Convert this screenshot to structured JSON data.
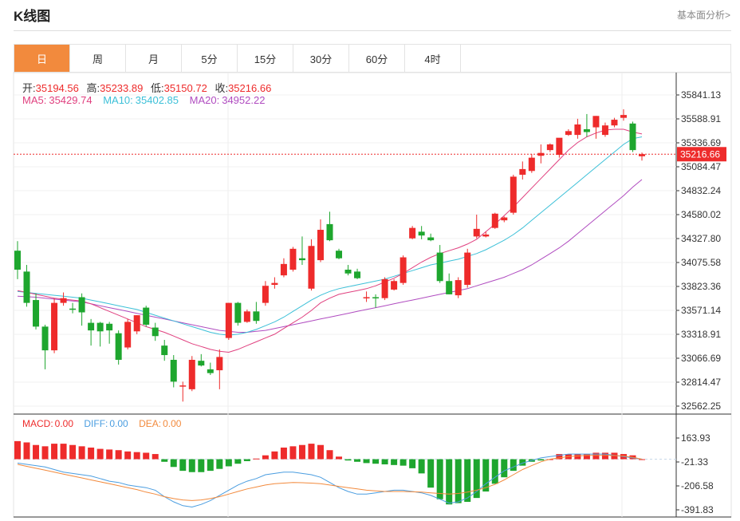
{
  "page": {
    "title": "K线图",
    "sublink": "基本面分析>"
  },
  "tabs": [
    "日",
    "周",
    "月",
    "5分",
    "15分",
    "30分",
    "60分",
    "4时"
  ],
  "active_tab": "日",
  "ohlc_info": {
    "open_label": "开:",
    "open": "35194.56",
    "high_label": "高:",
    "high": "35233.89",
    "low_label": "低:",
    "low": "35150.72",
    "close_label": "收:",
    "close": "35216.66"
  },
  "ma_info": {
    "ma5_label": "MA5:",
    "ma5": "35429.74",
    "ma10_label": "MA10:",
    "ma10": "35402.85",
    "ma20_label": "MA20:",
    "ma20": "34952.22"
  },
  "macd_info": {
    "macd_label": "MACD:",
    "macd": "0.00",
    "diff_label": "DIFF:",
    "diff": "0.00",
    "dea_label": "DEA:",
    "dea": "0.00"
  },
  "colors": {
    "up": "#ee2b2b",
    "down": "#1ea62e",
    "ma5": "#e0407f",
    "ma10": "#3cc0d8",
    "ma20": "#b04cc0",
    "diff": "#4a9de0",
    "dea": "#f28a3d",
    "active_tab": "#f28a3d",
    "price_tag": "#ee2b2b"
  },
  "chart_data": {
    "type": "candlestick",
    "price_axis_ticks": [
      "35841.13",
      "35588.91",
      "35336.69",
      "35084.47",
      "34832.24",
      "34580.02",
      "34327.80",
      "34075.58",
      "33823.36",
      "33571.14",
      "33318.91",
      "33066.69",
      "32814.47",
      "32562.25"
    ],
    "price_range": [
      32562.25,
      35841.13
    ],
    "last_price_tag": "35216.66",
    "macd_axis_ticks": [
      "163.93",
      "-21.33",
      "-206.58",
      "-391.83"
    ],
    "macd_range": [
      -391.83,
      163.93
    ],
    "candles": [
      [
        34200,
        34300,
        33900,
        34000
      ],
      [
        33980,
        34050,
        33610,
        33650
      ],
      [
        33680,
        33750,
        33370,
        33400
      ],
      [
        33400,
        33420,
        32950,
        33150
      ],
      [
        33150,
        33700,
        33120,
        33650
      ],
      [
        33650,
        33760,
        33620,
        33700
      ],
      [
        33590,
        33650,
        33540,
        33580
      ],
      [
        33710,
        33750,
        33410,
        33550
      ],
      [
        33440,
        33480,
        33200,
        33360
      ],
      [
        33440,
        33450,
        33190,
        33350
      ],
      [
        33430,
        33450,
        33220,
        33360
      ],
      [
        33330,
        33360,
        33000,
        33050
      ],
      [
        33180,
        33480,
        33160,
        33450
      ],
      [
        33350,
        33520,
        33320,
        33520
      ],
      [
        33600,
        33620,
        33400,
        33420
      ],
      [
        33390,
        33440,
        33250,
        33300
      ],
      [
        33200,
        33260,
        33040,
        33100
      ],
      [
        33050,
        33100,
        32760,
        32820
      ],
      [
        32780,
        32820,
        32610,
        32780
      ],
      [
        32740,
        33090,
        32720,
        33050
      ],
      [
        33040,
        33110,
        32980,
        32990
      ],
      [
        32950,
        33020,
        32890,
        32910
      ],
      [
        32940,
        33160,
        32740,
        33080
      ],
      [
        33280,
        33650,
        33260,
        33650
      ],
      [
        33650,
        33660,
        33410,
        33440
      ],
      [
        33450,
        33580,
        33440,
        33560
      ],
      [
        33560,
        33660,
        33430,
        33460
      ],
      [
        33650,
        33880,
        33620,
        33830
      ],
      [
        33840,
        33920,
        33800,
        33860
      ],
      [
        33940,
        34120,
        33920,
        34060
      ],
      [
        34000,
        34240,
        33980,
        34220
      ],
      [
        34120,
        34350,
        34050,
        34100
      ],
      [
        33800,
        34320,
        33780,
        34250
      ],
      [
        34100,
        34530,
        34080,
        34420
      ],
      [
        34480,
        34610,
        34300,
        34310
      ],
      [
        34200,
        34220,
        34110,
        34120
      ],
      [
        34000,
        34050,
        33940,
        33960
      ],
      [
        33980,
        34010,
        33900,
        33910
      ],
      [
        33700,
        33770,
        33660,
        33710
      ],
      [
        33710,
        33740,
        33600,
        33700
      ],
      [
        33700,
        33920,
        33680,
        33900
      ],
      [
        33790,
        33900,
        33780,
        33880
      ],
      [
        33860,
        34150,
        33840,
        34130
      ],
      [
        34330,
        34460,
        34320,
        34440
      ],
      [
        34400,
        34460,
        34320,
        34360
      ],
      [
        34340,
        34380,
        34300,
        34310
      ],
      [
        34180,
        34260,
        33860,
        33880
      ],
      [
        33880,
        33960,
        33740,
        33740
      ],
      [
        33730,
        33920,
        33700,
        33890
      ],
      [
        33840,
        34220,
        33810,
        34180
      ],
      [
        34350,
        34580,
        34330,
        34430
      ],
      [
        34350,
        34400,
        34340,
        34370
      ],
      [
        34440,
        34600,
        34430,
        34590
      ],
      [
        34520,
        34560,
        34500,
        34550
      ],
      [
        34600,
        35000,
        34580,
        34980
      ],
      [
        35000,
        35140,
        34950,
        35060
      ],
      [
        35040,
        35220,
        35020,
        35180
      ],
      [
        35200,
        35320,
        35120,
        35230
      ],
      [
        35260,
        35330,
        35240,
        35320
      ],
      [
        35210,
        35380,
        35180,
        35390
      ],
      [
        35420,
        35480,
        35410,
        35460
      ],
      [
        35420,
        35590,
        35380,
        35530
      ],
      [
        35480,
        35640,
        35400,
        35450
      ],
      [
        35500,
        35620,
        35380,
        35620
      ],
      [
        35420,
        35550,
        35400,
        35520
      ],
      [
        35520,
        35600,
        35500,
        35580
      ],
      [
        35600,
        35690,
        35570,
        35630
      ],
      [
        35540,
        35560,
        35240,
        35260
      ],
      [
        35195,
        35234,
        35150,
        35217
      ]
    ],
    "ma5": [
      33780,
      33760,
      33740,
      33720,
      33700,
      33690,
      33680,
      33670,
      33640,
      33600,
      33560,
      33520,
      33480,
      33440,
      33400,
      33370,
      33340,
      33300,
      33260,
      33220,
      33190,
      33160,
      33140,
      33130,
      33160,
      33200,
      33240,
      33280,
      33320,
      33380,
      33440,
      33500,
      33570,
      33650,
      33700,
      33740,
      33760,
      33780,
      33800,
      33830,
      33870,
      33910,
      33960,
      34020,
      34080,
      34130,
      34170,
      34200,
      34230,
      34270,
      34320,
      34400,
      34480,
      34570,
      34660,
      34760,
      34860,
      34960,
      35060,
      35160,
      35260,
      35340,
      35400,
      35440,
      35470,
      35480,
      35480,
      35450,
      35430
    ],
    "ma10": [
      33770,
      33760,
      33750,
      33740,
      33730,
      33720,
      33710,
      33700,
      33680,
      33660,
      33640,
      33620,
      33600,
      33580,
      33550,
      33520,
      33490,
      33460,
      33430,
      33400,
      33370,
      33340,
      33320,
      33310,
      33320,
      33340,
      33370,
      33410,
      33450,
      33500,
      33560,
      33620,
      33680,
      33730,
      33770,
      33800,
      33820,
      33840,
      33860,
      33880,
      33900,
      33930,
      33960,
      33990,
      34020,
      34050,
      34070,
      34090,
      34110,
      34140,
      34170,
      34210,
      34260,
      34310,
      34370,
      34440,
      34520,
      34600,
      34680,
      34760,
      34840,
      34920,
      35000,
      35080,
      35160,
      35240,
      35320,
      35380,
      35400
    ],
    "ma20": [
      33720,
      33715,
      33710,
      33700,
      33690,
      33680,
      33670,
      33660,
      33640,
      33620,
      33600,
      33580,
      33560,
      33540,
      33520,
      33500,
      33480,
      33460,
      33440,
      33420,
      33400,
      33380,
      33360,
      33350,
      33340,
      33340,
      33350,
      33360,
      33380,
      33400,
      33420,
      33440,
      33460,
      33480,
      33500,
      33520,
      33540,
      33560,
      33580,
      33600,
      33620,
      33640,
      33660,
      33680,
      33700,
      33720,
      33740,
      33760,
      33780,
      33800,
      33830,
      33860,
      33890,
      33920,
      33960,
      34000,
      34050,
      34110,
      34170,
      34230,
      34300,
      34380,
      34460,
      34540,
      34620,
      34700,
      34780,
      34870,
      34950
    ],
    "macd_hist": [
      140,
      130,
      110,
      100,
      120,
      120,
      110,
      100,
      90,
      80,
      75,
      70,
      60,
      55,
      50,
      40,
      -20,
      -60,
      -90,
      -100,
      -100,
      -90,
      -75,
      -55,
      -35,
      -15,
      5,
      30,
      60,
      90,
      100,
      110,
      120,
      110,
      70,
      20,
      -10,
      -20,
      -30,
      -35,
      -40,
      -45,
      -50,
      -70,
      -110,
      -220,
      -310,
      -350,
      -340,
      -330,
      -300,
      -250,
      -190,
      -140,
      -90,
      -50,
      -20,
      -10,
      0,
      40,
      40,
      40,
      40,
      50,
      50,
      50,
      40,
      30,
      0
    ],
    "diff": [
      -30,
      -40,
      -50,
      -60,
      -80,
      -100,
      -110,
      -120,
      -130,
      -150,
      -170,
      -180,
      -200,
      -210,
      -220,
      -240,
      -290,
      -330,
      -360,
      -370,
      -350,
      -320,
      -280,
      -240,
      -200,
      -170,
      -150,
      -120,
      -110,
      -100,
      -100,
      -110,
      -120,
      -140,
      -180,
      -220,
      -250,
      -270,
      -270,
      -260,
      -250,
      -240,
      -240,
      -250,
      -260,
      -280,
      -310,
      -340,
      -330,
      -300,
      -250,
      -190,
      -140,
      -90,
      -60,
      -30,
      -10,
      10,
      20,
      30,
      40,
      40,
      40,
      40,
      40,
      30,
      20,
      10,
      0
    ],
    "dea": [
      -40,
      -55,
      -70,
      -85,
      -100,
      -115,
      -130,
      -145,
      -160,
      -175,
      -190,
      -205,
      -220,
      -235,
      -255,
      -270,
      -290,
      -305,
      -315,
      -320,
      -315,
      -305,
      -290,
      -270,
      -250,
      -230,
      -215,
      -200,
      -190,
      -185,
      -180,
      -182,
      -185,
      -190,
      -200,
      -210,
      -220,
      -230,
      -240,
      -245,
      -250,
      -250,
      -250,
      -252,
      -255,
      -260,
      -265,
      -270,
      -265,
      -255,
      -240,
      -220,
      -195,
      -160,
      -120,
      -80,
      -50,
      -20,
      0,
      10,
      20,
      25,
      30,
      30,
      30,
      28,
      25,
      15,
      0
    ]
  }
}
